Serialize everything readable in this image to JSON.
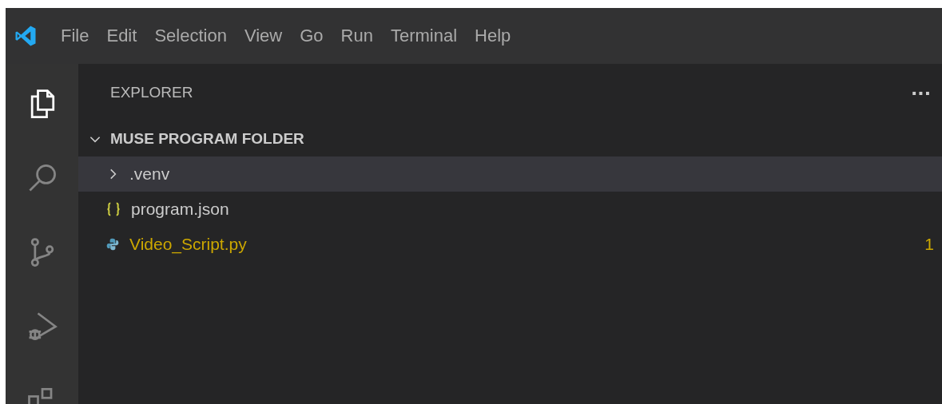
{
  "menu_bar": {
    "items": [
      "File",
      "Edit",
      "Selection",
      "View",
      "Go",
      "Run",
      "Terminal",
      "Help"
    ]
  },
  "activity_bar": [
    {
      "kind": "files",
      "selected": true
    },
    {
      "kind": "search",
      "selected": false
    },
    {
      "kind": "source-control",
      "selected": false
    },
    {
      "kind": "run-debug",
      "selected": false
    },
    {
      "kind": "extensions",
      "selected": false
    }
  ],
  "explorer": {
    "title": "EXPLORER",
    "more": "···",
    "folder": {
      "name": "MUSE PROGRAM FOLDER",
      "expanded": true,
      "items": [
        {
          "kind": "folder",
          "name": ".venv",
          "expanded": false,
          "selected": true,
          "warning": false
        },
        {
          "kind": "json",
          "name": "program.json",
          "selected": false,
          "warning": false
        },
        {
          "kind": "python",
          "name": "Video_Script.py",
          "selected": false,
          "warning": true,
          "badge": "1"
        }
      ]
    }
  }
}
